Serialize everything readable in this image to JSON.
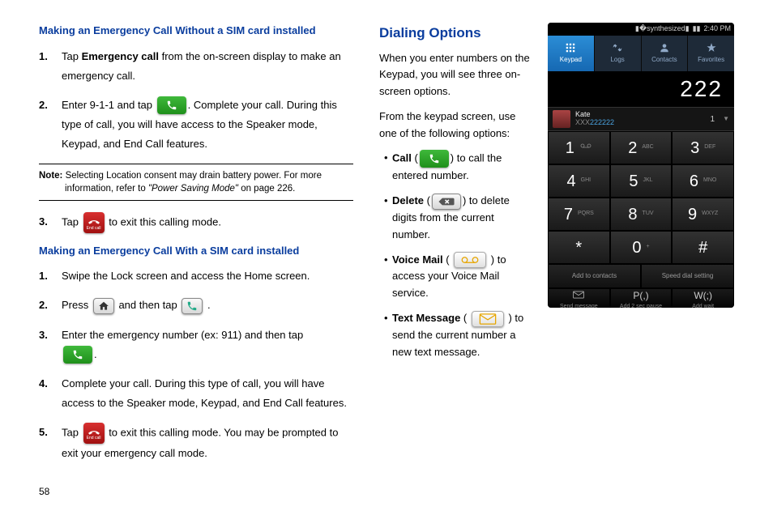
{
  "page_number": "58",
  "left": {
    "heading1": "Making an Emergency Call Without a SIM card installed",
    "step1_pre": "Tap ",
    "step1_bold": "Emergency call",
    "step1_post": " from the on-screen display to make an emergency call.",
    "step2_pre": "Enter 9-1-1 and tap ",
    "step2_post": ". Complete your call. During this type of call, you will have access to the Speaker mode, Keypad, and End Call features.",
    "note_label": "Note:",
    "note_line1": " Selecting Location consent may drain battery power. For more",
    "note_line2_pre": "information, refer to ",
    "note_line2_italic": "\"Power Saving Mode\"",
    "note_line2_post": "  on page 226.",
    "step3_pre": "Tap ",
    "step3_post": " to exit this calling mode.",
    "heading2": "Making an Emergency Call With a SIM card installed",
    "s2_1": "Swipe the Lock screen and access the Home screen.",
    "s2_2_pre": "Press ",
    "s2_2_mid": " and then tap ",
    "s2_2_post": " .",
    "s2_3_pre": "Enter the emergency number (ex: 911) and then tap",
    "s2_3_post": ".",
    "s2_4": "Complete your call. During this type of call, you will have access to the Speaker mode, Keypad, and End Call features.",
    "s2_5_pre": "Tap ",
    "s2_5_post": " to exit this calling mode. You may be prompted to exit your emergency call mode."
  },
  "right": {
    "heading": "Dialing Options",
    "p1": "When you enter numbers on the Keypad, you will see three on-screen options.",
    "p2": "From the keypad screen, use one of the following options:",
    "b_call_label": "Call",
    "b_call_post": ") to call the entered number.",
    "b_delete_label": "Delete",
    "b_delete_post": ") to delete digits from the current number.",
    "b_vm_label": "Voice Mail",
    "b_vm_post": " ) to access your Voice Mail service.",
    "b_txt_label": "Text Message",
    "b_txt_post": " ) to send the current number a new text message."
  },
  "phone": {
    "time": "2:40 PM",
    "tabs": [
      "Keypad",
      "Logs",
      "Contacts",
      "Favorites"
    ],
    "number": "222",
    "contact_name": "Kate",
    "contact_num_prefix": "XXX",
    "contact_num_suffix": "222222",
    "contact_count": "1",
    "keys": [
      {
        "d": "1",
        "l": ""
      },
      {
        "d": "2",
        "l": "ABC"
      },
      {
        "d": "3",
        "l": "DEF"
      },
      {
        "d": "4",
        "l": "GHI"
      },
      {
        "d": "5",
        "l": "JKL"
      },
      {
        "d": "6",
        "l": "MNO"
      },
      {
        "d": "7",
        "l": "PQRS"
      },
      {
        "d": "8",
        "l": "TUV"
      },
      {
        "d": "9",
        "l": "WXYZ"
      },
      {
        "d": "*",
        "l": ""
      },
      {
        "d": "0",
        "l": "+"
      },
      {
        "d": "#",
        "l": ""
      }
    ],
    "bottom1": [
      "Add to contacts",
      "Speed dial setting"
    ],
    "bottom2_labels": [
      "Send message",
      "Add 2 sec pause",
      "Add wait"
    ],
    "bottom2_big": [
      "",
      "P(,)",
      "W(;)"
    ]
  }
}
